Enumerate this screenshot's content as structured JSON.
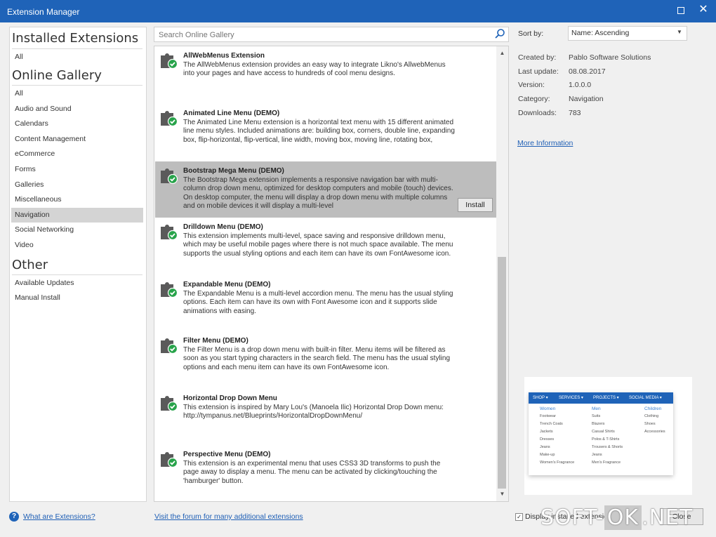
{
  "window": {
    "title": "Extension Manager"
  },
  "sidebar": {
    "installed_title": "Installed Extensions",
    "installed_items": [
      {
        "label": "All"
      }
    ],
    "gallery_title": "Online Gallery",
    "gallery_items": [
      {
        "label": "All"
      },
      {
        "label": "Audio and Sound"
      },
      {
        "label": "Calendars"
      },
      {
        "label": "Content Management"
      },
      {
        "label": "eCommerce"
      },
      {
        "label": "Forms"
      },
      {
        "label": "Galleries"
      },
      {
        "label": "Miscellaneous"
      },
      {
        "label": "Navigation"
      },
      {
        "label": "Social Networking"
      },
      {
        "label": "Video"
      }
    ],
    "active_gallery_item": "Navigation",
    "other_title": "Other",
    "other_items": [
      {
        "label": "Available Updates"
      },
      {
        "label": "Manual Install"
      }
    ]
  },
  "search": {
    "placeholder": "Search Online Gallery",
    "value": ""
  },
  "extensions": [
    {
      "name": "AllWebMenus Extension",
      "description": "The AllWebMenus extension provides an easy way to integrate Likno's AllwebMenus into your pages and have access to hundreds of cool menu designs.",
      "installed": true
    },
    {
      "name": "Animated Line Menu (DEMO)",
      "description": "The Animated Line Menu extension is a horizontal text menu with 15 different animated line menu styles. Included animations are: building box, corners, double line, expanding box, flip-horizontal, flip-vertical, line width, moving box, moving line, rotating box,",
      "installed": true
    },
    {
      "name": "Bootstrap Mega Menu (DEMO)",
      "description": "The Bootstrap Mega extension implements a responsive navigation bar with multi-column drop down menu, optimized for desktop computers and mobile (touch) devices. On desktop computer, the menu will display a drop down menu with multiple columns and on mobile devices it will display a multi-level",
      "installed": true,
      "selected": true,
      "action": "Install"
    },
    {
      "name": "Drilldown Menu (DEMO)",
      "description": "This extension implements multi-level, space saving and responsive drilldown menu, which may be useful mobile pages where there is not much space available. The menu supports the usual styling options and each item can have its own FontAwesome icon.",
      "installed": true
    },
    {
      "name": "Expandable Menu (DEMO)",
      "description": "The Expandable Menu is a multi-level accordion menu. The menu has the usual styling options. Each item can have its own with Font Awesome icon and it supports slide animations with easing.",
      "installed": true
    },
    {
      "name": "Filter Menu (DEMO)",
      "description": "The Filter Menu is a drop down menu with built-in filter. Menu items will be filtered as soon as you start typing characters in the search field. The menu has the usual styling options and each menu item can have its own FontAwesome icon.",
      "installed": true
    },
    {
      "name": "Horizontal Drop Down Menu",
      "description": "This extension is inspired by Mary Lou's (Manoela Ilic) Horizontal Drop Down menu: http://tympanus.net/Blueprints/HorizontalDropDownMenu/",
      "installed": true
    },
    {
      "name": "Perspective Menu (DEMO)",
      "description": "This extension is an experimental menu that uses CSS3 3D transforms to push the page away to display a menu. The menu can be activated by clicking/touching the 'hamburger' button.",
      "installed": true
    }
  ],
  "sort": {
    "label": "Sort by:",
    "value": "Name: Ascending"
  },
  "details": [
    {
      "label": "Created by:",
      "value": "Pablo Software Solutions"
    },
    {
      "label": "Last update:",
      "value": "08.08.2017"
    },
    {
      "label": "Version:",
      "value": "1.0.0.0"
    },
    {
      "label": "Category:",
      "value": "Navigation"
    },
    {
      "label": "Downloads:",
      "value": "783"
    }
  ],
  "more_info": "More Information",
  "preview": {
    "tabs": [
      "SHOP ▾",
      "SERVICES ▾",
      "PROJECTS ▾",
      "SOCIAL MEDIA ▾"
    ],
    "columns": [
      {
        "heading": "Women",
        "items": [
          "Footwear",
          "Trench Coats",
          "Jackets",
          "Dresses",
          "Jeans",
          "Make-up",
          "Women's Fragrance"
        ]
      },
      {
        "heading": "Men",
        "items": [
          "Suits",
          "Blazers",
          "Casual Shirts",
          "Polos & T-Shirts",
          "Trousers & Shorts",
          "Jeans",
          "Men's Fragrance"
        ]
      },
      {
        "heading": "Children",
        "items": [
          "Clothing",
          "Shoes",
          "Accessories"
        ]
      }
    ]
  },
  "footer": {
    "help_link": "What are Extensions?",
    "forum_link": "Visit the forum for many additional extensions",
    "checkbox_label": "Display installed extensions only",
    "checkbox_checked": true,
    "close": "Close"
  },
  "watermark": {
    "part1": "SOFT-",
    "part2": "OK",
    "part3": ".NET"
  },
  "colors": {
    "accent": "#1f63b8",
    "selected_row": "#bdbdbd",
    "check_green": "#27a34a"
  }
}
